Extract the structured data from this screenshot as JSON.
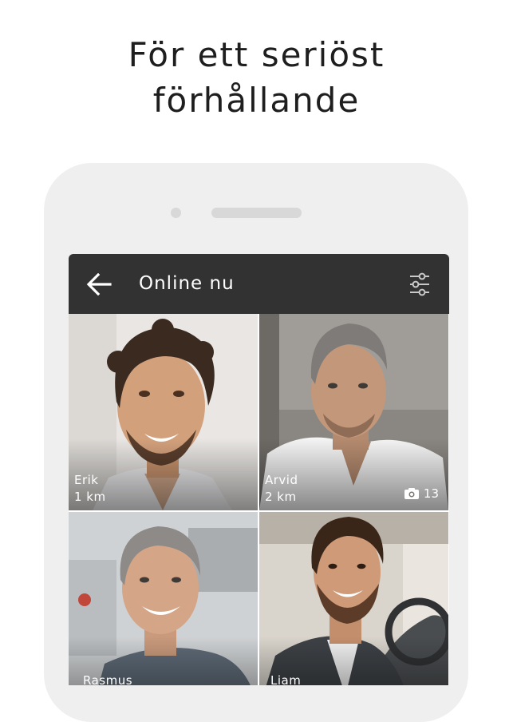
{
  "headline": {
    "line1": "För ett seriöst",
    "line2": "förhållande"
  },
  "appbar": {
    "title": "Online nu",
    "back_icon": "arrow-left-icon",
    "filter_icon": "sliders-icon"
  },
  "profiles": [
    {
      "name": "Erik",
      "distance": "1 km",
      "photo_count": ""
    },
    {
      "name": "Arvid",
      "distance": "2 km",
      "photo_count": "13"
    },
    {
      "name": "Rasmus",
      "distance": "",
      "photo_count": ""
    },
    {
      "name": "Liam",
      "distance": "",
      "photo_count": ""
    }
  ],
  "colors": {
    "appbar": "#323232",
    "phone": "#efefef",
    "headline": "#1e1e1e"
  }
}
